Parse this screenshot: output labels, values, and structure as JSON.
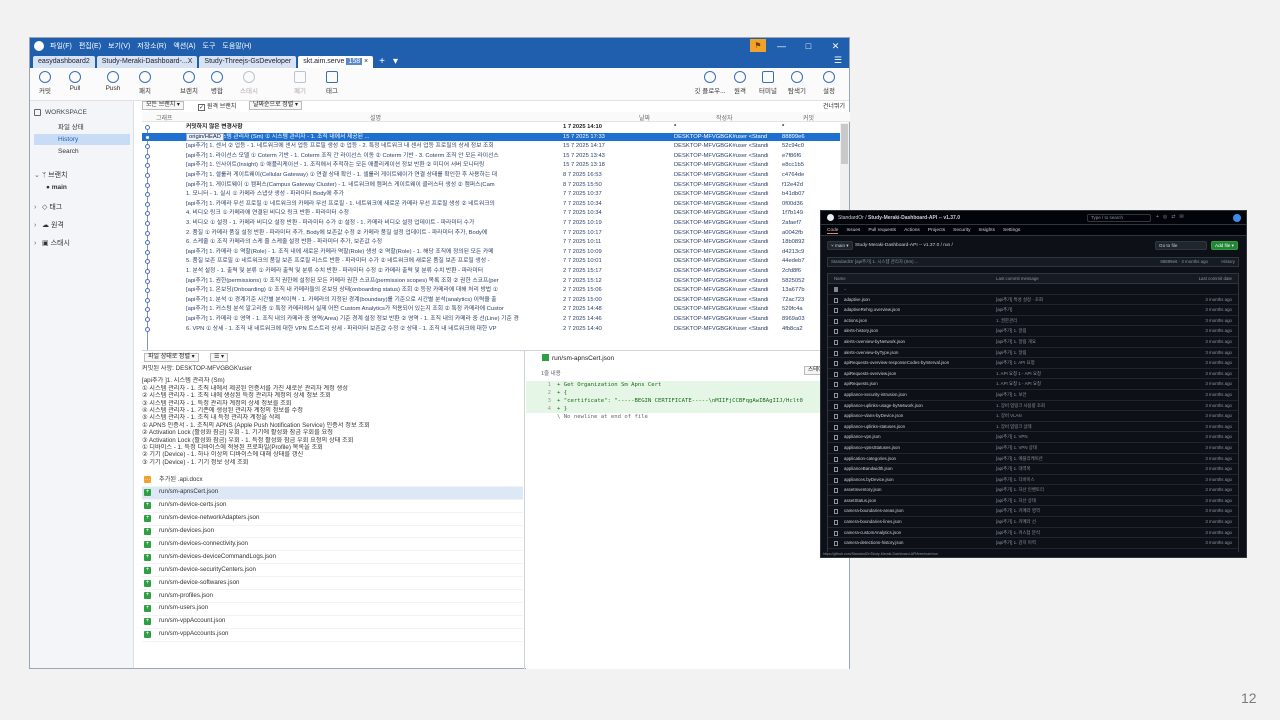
{
  "app": {
    "menu": [
      "파일(F)",
      "편집(E)",
      "보기(V)",
      "저장소(R)",
      "액션(A)",
      "도구",
      "도움말(H)"
    ],
    "flag_icon": "flag-icon",
    "window_controls": [
      "—",
      "□",
      "✕"
    ]
  },
  "tabs": [
    {
      "label": "easydashboard2",
      "active": false
    },
    {
      "label": "Study-Meraki-Dashboard-...X",
      "active": false
    },
    {
      "label": "Study-Threejs-GsDeveloper",
      "active": false
    },
    {
      "label": "skt.aim.serve",
      "badge": "158",
      "active": true
    }
  ],
  "toolbar": {
    "left": [
      "커밋",
      "Pull",
      "Push",
      "패치",
      "브랜치",
      "병합",
      "스태시",
      "폐기",
      "태그"
    ],
    "right": [
      "깃 플로우...",
      "원격",
      "터미널",
      "탐색기",
      "설정"
    ]
  },
  "sidebar": {
    "workspace": "WORKSPACE",
    "items": [
      "파일 상태",
      "History",
      "Search"
    ],
    "sections": [
      {
        "label": "브랜치",
        "expanded": true,
        "children": [
          "main"
        ]
      },
      {
        "label": "태그",
        "expanded": false
      },
      {
        "label": "원격",
        "expanded": false
      },
      {
        "label": "스태시",
        "expanded": false
      }
    ]
  },
  "filters": {
    "branches": "모든 브랜치 ▾",
    "show_remote": "원격 브랜치",
    "sort": "날짜순으로 정렬 ▾",
    "jump": "건너뛰기"
  },
  "grid_header": {
    "graph": "그래프",
    "desc": "설명",
    "date": "날짜",
    "author": "작성자",
    "commit": "커밋"
  },
  "commits": [
    {
      "msg": "커밋하지 않은 변경사항",
      "date": "1 7 2025 14:10",
      "author": "*",
      "hash": "*",
      "type": "uncommitted"
    },
    {
      "tags": [
        "main",
        "origin/main",
        "origin/HEAD"
      ],
      "msg": "[api추가 ]1. 시스템 관리자 (Sm) ① 시스템 관리자 - 1. 조직 내에서 제공된 ...",
      "date": "15 7 2025 17:33",
      "author": "DESKTOP-MFVGBGK#user <Stand",
      "hash": "88899e6",
      "type": "selected"
    },
    {
      "msg": "[api추가] 1. 센서 ② 업등 - 1. 네트워크에 센서 업등 프로필 생성 ② 업등 - 2. 특정 네트워크 내 센서 업등 프로필의 상세 정보 조회",
      "date": "15 7 2025 14:17",
      "author": "DESKTOP-MFVGBGK#user <Standi",
      "hash": "52c94c0"
    },
    {
      "msg": "[api추가] 1. 라이선스 모델 ① Coterm 기반 - 1. Coterm 조직 간 라이선스 이동 ② Coterm 기반 - 3. Coterm 조직 안 모든 라이선스",
      "date": "15 7 2025 13:43",
      "author": "DESKTOP-MFVGBGK#user <Standi",
      "hash": "e7f86f6"
    },
    {
      "msg": "[api추가] 1. 인사이트(Insight) ① 애플리케이션 - 1. 조직에서 추적하는 모든 애플리케이션 정보 반환 ② 미디어 서버 모니터링",
      "date": "15 7 2025 13:18",
      "author": "DESKTOP-MFVGBGK#user <Standi",
      "hash": "e8cc1b5"
    },
    {
      "msg": "[api추가] 1. 셀룰러 게이트웨이(Cellular Gateway) ① 연결 상태 확인 - 1. 셀룰러 게이트웨이가 연결 상태를 확인한 후 사용하는 대",
      "date": "8 7 2025 16:53",
      "author": "DESKTOP-MFVGBGK#user <Standi",
      "hash": "c4764de"
    },
    {
      "msg": "[api추가] 1. 게이트웨이 ① 캠퍼스(Campus Gateway Cluster) - 1. 네트워크에 캠퍼스 게이트웨이 클러스터 생성 ② 캠퍼스(Cam",
      "date": "8 7 2025 15:50",
      "author": "DESKTOP-MFVGBGK#user <Standi",
      "hash": "f12e42d"
    },
    {
      "msg": "1. 모니터 - 1. 실시 ① 카메라 스냅샷 생성 - 파라미터 Body에 추가",
      "date": "7 7 2025 10:37",
      "author": "DESKTOP-MFVGBGK#user <Standi",
      "hash": "b41db07"
    },
    {
      "msg": "[api추가] 1. 카메라 무선 프로필 ① 네트워크의 카메라 무선 프로필 - 1. 네트워크에 새로운 카메라 무선 프로필 생성 ② 네트워크의",
      "date": "7 7 2025 10:34",
      "author": "DESKTOP-MFVGBGK#user <Standi",
      "hash": "0f00d36"
    },
    {
      "msg": "4. 비디오 링크 ① 카메라에 연결된 비디오 링크 반환 - 파라미터 수정",
      "date": "7 7 2025 10:34",
      "author": "DESKTOP-MFVGBGK#user <Standi",
      "hash": "1f7b149"
    },
    {
      "msg": "3. 비디오 ① 설정 - 1. 카메라 비디오 설정 반환 - 파라미터 수가 ② 설정 - 1. 카메라 비디오 설정 업데이트 - 파라미터 수가",
      "date": "7 7 2025 10:19",
      "author": "DESKTOP-MFVGBGK#user <Standi",
      "hash": "2afaef7"
    },
    {
      "msg": "2. 품질 ① 카메라 품질 설정 반환 - 파라미터 추가, Body에 보존값 수정 ② 카메라 품질 설정 업데이트 - 파라미터 추가, Body에",
      "date": "7 7 2025 10:17",
      "author": "DESKTOP-MFVGBGK#user <Standi",
      "hash": "a0042fb"
    },
    {
      "msg": "6. 스케줄 ① 조직 카메라의 스케 줄 스케줄 설정 반환 - 파라미터 추가, 보존값 수정",
      "date": "7 7 2025 10:11",
      "author": "DESKTOP-MFVGBGK#user <Standi",
      "hash": "18b0892"
    },
    {
      "msg": "[api추가] 1. 카메라 ① 역할(Role) - 1. 조직 내에 새로운 카메라 역할(Role) 생성 ② 역할(Role) - 1. 해당 조직에 정의된 모든 카메",
      "date": "7 7 2025 10:09",
      "author": "DESKTOP-MFVGBGK#user <Standi",
      "hash": "d4213c9"
    },
    {
      "msg": "5. 품질 보존 프로필 ① 네트워크의 품질 보존 프로필 리스트 반환 - 파라미터 수가 ② 네트워크에 새로운 품질 보존 프로필 생성 -",
      "date": "7 7 2025 10:01",
      "author": "DESKTOP-MFVGBGK#user <Standi",
      "hash": "44edeb7"
    },
    {
      "msg": "1. 분석 설정 - 1. 출력 및 분류 ① 카메라 출력 및 분류 수치 반환 - 파라미터 수정 ② 카메라 출력 및 분류 수치 반환 - 파라미터",
      "date": "2 7 2025 15:17",
      "author": "DESKTOP-MFVGBGK#user <Standi",
      "hash": "2cfd8f6"
    },
    {
      "msg": "[api추가] 1. 권한(permissions) ① 조직 권한에 설정된 모든 카메라 권한 스코프(permission scopes) 목록 조회 ② 권한 스코프(per",
      "date": "2 7 2025 15:12",
      "author": "DESKTOP-MFVGBGK#user <Standi",
      "hash": "5825052"
    },
    {
      "msg": "[api추가] 1. 온보딩(Onboarding) ① 조직 내 카메라들의 온보딩 상태(onboarding status) 조회 ② 등장 카메라에 대해 처리 방법 ①",
      "date": "2 7 2025 15:06",
      "author": "DESKTOP-MFVGBGK#user <Standi",
      "hash": "13a677b"
    },
    {
      "msg": "[api추가] 1. 분석 ① 경계기준 시간별 분석이력 - 1. 카메라의 지정된 경계(boundary)를 기준으로 시간별 분석(analytics) 이력을 출",
      "date": "2 7 2025 15:00",
      "author": "DESKTOP-MFVGBGK#user <Standi",
      "hash": "72ac723"
    },
    {
      "msg": "[api추가] 1. 커스텀 분석 알고리즘 ① 특정 카메라에서 실제 어떤 Custom Analytics가 적용되어 있는지 조회 ② 특정 카메라에 Custor",
      "date": "2 7 2025 14:48",
      "author": "DESKTOP-MFVGBGK#user <Standi",
      "hash": "529fc4a"
    },
    {
      "msg": "[api추가] 1. 카메라 ① 영역 - 1. 조직 내의 카메라 중 영역(Area) 기준 경계 설정 정보 반환 ② 영역 - 1. 조직 내의 카메라 중 선(Line) 기준 경",
      "date": "2 7 2025 14:46",
      "author": "DESKTOP-MFVGBGK#user <Standi",
      "hash": "8969a03"
    },
    {
      "msg": "6. VPN ① 상세 - 1. 조직 내 네트워크에 대한 VPN 트스트리 상세 - 파라미터 보존값 수정 ② 상태 - 1. 조직 내 네트워크에 대한 VP",
      "date": "2 7 2025 14:40",
      "author": "DESKTOP-MFVGBGK#user <Standi",
      "hash": "4fb8ca2"
    }
  ],
  "file_status": {
    "sort": "파일 상태로 정렬 ▾",
    "view": "☰ ▾",
    "author": "커밋된 사항: DESKTOP-MFVGBGK\\user",
    "lines": [
      "[api추가 ]1. 시스템 관리자 (Sm)",
      "① 시스템 관리자 - 1. 조직 내에서 제공된 인증서를 가진 새로운 관리자 계정 생성",
      "② 시스템 관리자 - 1. 조직 내에 생성된 특정 관리자 계정의 상세 정보 조회",
      "③ 시스템 관리자 - 1. 특정 관리자 계정의 상세 정보를 조회",
      "④ 시스템 관리자 - 1. 기존에 생성된 관리자 계정의 정보를 수정",
      "⑤ 시스템 관리자 - 1. 조직 내 특정 관리자 계정을 삭제",
      "① APNS 인증서 - 1. 조직의 APNS (Apple Push Notification Service) 인증서 정보 조회",
      "② Activation Lock (활성화 잠금) 우회 - 1. 기기에 활성화 잠금 우회를 요청",
      "③ Activation Lock (활성화 잠금) 우회 - 1. 특정 활성화 잠금 우회 요청의 상태 조회",
      "① 디바이스 - 1. 특정 디바이스에 적용된 프로파일(Profile) 목록을 조회",
      "② 기기 (Device) - 1. 하나 이상의 디바이스에 대해 상태를 갱신",
      "③ 기기 (Device) - 1. 기기 정보 상세 조회"
    ]
  },
  "files": [
    {
      "name": "추가된 .api.docx",
      "status": "modified"
    },
    {
      "name": "run/sm-apnsCert.json",
      "status": "added",
      "selected": true
    },
    {
      "name": "run/sm-device-certs.json",
      "status": "added"
    },
    {
      "name": "run/sm-device-networkAdapters.json",
      "status": "added"
    },
    {
      "name": "run/sm-devices.json",
      "status": "added"
    },
    {
      "name": "run/sm-devices-connectivity.json",
      "status": "added"
    },
    {
      "name": "run/sm-devices-deviceCommandLogs.json",
      "status": "added"
    },
    {
      "name": "run/sm-device-securityCenters.json",
      "status": "added"
    },
    {
      "name": "run/sm-device-softwares.json",
      "status": "added"
    },
    {
      "name": "run/sm-profiles.json",
      "status": "added"
    },
    {
      "name": "run/sm-users.json",
      "status": "added"
    },
    {
      "name": "run/sm-vppAccount.json",
      "status": "added"
    },
    {
      "name": "run/sm-vppAccounts.json",
      "status": "added"
    }
  ],
  "diff": {
    "filename": "run/sm-apnsCert.json",
    "meta": "1줄 내용",
    "stage_button": "스테이지 나가기",
    "lines": [
      {
        "n": "1",
        "text": "+ Get Organization Sm Apns Cert",
        "type": "add"
      },
      {
        "n": "2",
        "text": "+ {",
        "type": "add"
      },
      {
        "n": "3",
        "text": "+   \"certificate\": \"-----BEGIN CERTIFICATE-----\\nMIIFjCCBFqgAwIBAgIIJ/Hclt0",
        "type": "add"
      },
      {
        "n": "4",
        "text": "+ }",
        "type": "add"
      },
      {
        "n": "",
        "text": "\\  No newline at end of file",
        "type": "note"
      }
    ]
  },
  "github": {
    "owner": "StandardOr",
    "repo": "Study-Meraki-Dashboard-API -- v1.37.0",
    "search_placeholder": "Type / to search",
    "nav": [
      "Code",
      "Issues",
      "Pull requests",
      "Actions",
      "Projects",
      "Security",
      "Insights",
      "Settings"
    ],
    "branch": "main",
    "breadcrumb": "Study-Meraki-Dashboard-API -- v1.37.0 / run /",
    "goto_file": "Go to file",
    "add_file": "Add file ▾",
    "commit_bar": "StandardOr  [api추가] 1. 시스템 관리자 (Sm) ...",
    "commit_meta": "88899e6 · 3 months ago",
    "history": "History",
    "col_name": "Name",
    "col_message": "Last commit message",
    "col_date": "Last commit date",
    "files": [
      {
        "name": "..",
        "msg": "",
        "date": "",
        "folder": true
      },
      {
        "name": "adaptive.json",
        "msg": "[api추가] 특성 설정 · 조회",
        "date": "3 months ago"
      },
      {
        "name": "adaptiveRehrg.overview.json",
        "msg": "[api추가]",
        "date": "3 months ago"
      },
      {
        "name": "actions.json",
        "msg": "1. 권한관리",
        "date": "3 months ago"
      },
      {
        "name": "alerts-history.json",
        "msg": "[api추가] 1. 알림",
        "date": "3 months ago"
      },
      {
        "name": "alerts-overview-byNetwork.json",
        "msg": "[api추가] 1. 알림 개요",
        "date": "3 months ago"
      },
      {
        "name": "alerts-overview-byType.json",
        "msg": "[api추가] 1. 알림",
        "date": "3 months ago"
      },
      {
        "name": "apiRequests-overview-responseCodes-byInterval.json",
        "msg": "[api추가] 1. API 요청",
        "date": "3 months ago"
      },
      {
        "name": "apiRequests-overview.json",
        "msg": "1. API 요청 1 - API 요청",
        "date": "3 months ago"
      },
      {
        "name": "apiRequests.json",
        "msg": "1. API 요청 1 - API 요청",
        "date": "3 months ago"
      },
      {
        "name": "appliance-security-intrusion.json",
        "msg": "[api추가] 1. 보안",
        "date": "3 months ago"
      },
      {
        "name": "appliance-uplinks-usage-byNetwork.json",
        "msg": "1. 장비 업링크 사용량 조회",
        "date": "3 months ago"
      },
      {
        "name": "appliance-vlans-byDevice.json",
        "msg": "1. 장비 VLAN",
        "date": "3 months ago"
      },
      {
        "name": "appliance-uplinks-statuses.json",
        "msg": "1. 장비 업링크 상태",
        "date": "3 months ago"
      },
      {
        "name": "appliance-vpn.json",
        "msg": "[api추가] 1. VPN",
        "date": "3 months ago"
      },
      {
        "name": "appliance-vpnsStatuses.json",
        "msg": "[api추가] 1. VPN 상태",
        "date": "3 months ago"
      },
      {
        "name": "application-categories.json",
        "msg": "[api추가] 1. 애플리케이션",
        "date": "3 months ago"
      },
      {
        "name": "applianceBandwidth.json",
        "msg": "[api추가] 1. 대역폭",
        "date": "3 months ago"
      },
      {
        "name": "appliances.byDevice.json",
        "msg": "[api추가] 1. 디바이스",
        "date": "3 months ago"
      },
      {
        "name": "assetInventory.json",
        "msg": "[api추가] 1. 자산 인벤토리",
        "date": "3 months ago"
      },
      {
        "name": "assetStatus.json",
        "msg": "[api추가] 1. 자산 상태",
        "date": "3 months ago"
      },
      {
        "name": "camera-boundaries-areas.json",
        "msg": "[api추가] 1. 카메라 영역",
        "date": "3 months ago"
      },
      {
        "name": "camera-boundaries-lines.json",
        "msg": "[api추가] 1. 카메라 선",
        "date": "3 months ago"
      },
      {
        "name": "camera-customAnalytics.json",
        "msg": "[api추가] 1. 커스텀 분석",
        "date": "3 months ago"
      },
      {
        "name": "camera-detections-history.json",
        "msg": "[api추가] 1. 감지 이력",
        "date": "3 months ago"
      }
    ],
    "status_url": "https://github.com/StandardOr/Study-Meraki-Dashboard-API/tree/main/run"
  },
  "page_number": "12"
}
